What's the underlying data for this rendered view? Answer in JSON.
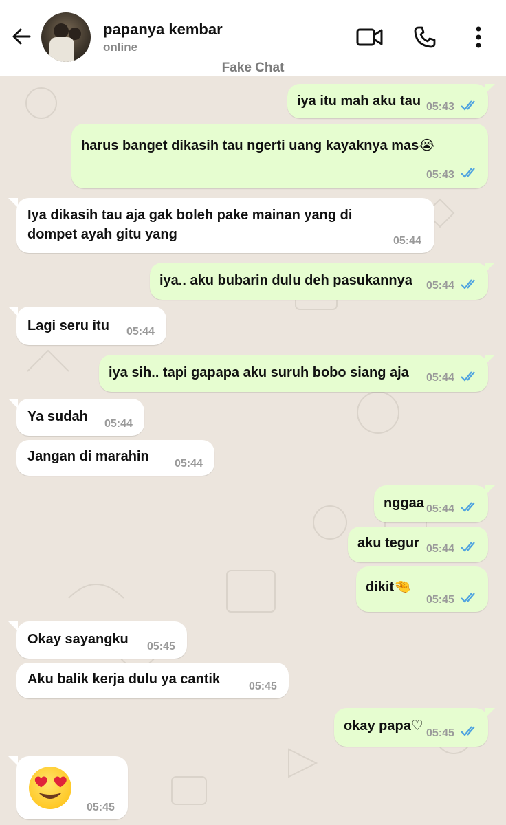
{
  "header": {
    "contact_name": "papanya kembar",
    "status": "online",
    "watermark": "Fake Chat"
  },
  "icons": {
    "back": "arrow-left-icon",
    "video": "video-camera-icon",
    "call": "phone-icon",
    "menu": "more-vertical-icon"
  },
  "colors": {
    "outgoing_bubble": "#e6fdd0",
    "incoming_bubble": "#ffffff",
    "background": "#ece5dd",
    "read_ticks": "#4fa3e0"
  },
  "messages": [
    {
      "dir": "out",
      "text": "iya itu mah aku tau",
      "time": "05:43"
    },
    {
      "dir": "out",
      "text": "harus banget dikasih tau ngerti uang kayaknya mas😭",
      "time": "05:43"
    },
    {
      "dir": "in",
      "text": "Iya dikasih tau aja gak boleh pake mainan yang di",
      "text2": "dompet ayah gitu yang",
      "time": "05:44"
    },
    {
      "dir": "out",
      "text": "iya.. aku bubarin dulu deh pasukannya",
      "time": "05:44"
    },
    {
      "dir": "in",
      "text": "Lagi seru itu",
      "time": "05:44"
    },
    {
      "dir": "out",
      "text": "iya sih.. tapi gapapa aku suruh bobo siang aja",
      "time": "05:44"
    },
    {
      "dir": "in",
      "text": "Ya sudah",
      "time": "05:44"
    },
    {
      "dir": "in",
      "text": "Jangan di marahin",
      "time": "05:44"
    },
    {
      "dir": "out",
      "text": "nggaa",
      "time": "05:44"
    },
    {
      "dir": "out",
      "text": "aku tegur",
      "time": "05:44"
    },
    {
      "dir": "out",
      "text": "dikit🤏",
      "time": "05:45"
    },
    {
      "dir": "in",
      "text": "Okay sayangku",
      "time": "05:45"
    },
    {
      "dir": "in",
      "text": "Aku balik kerja dulu ya cantik",
      "time": "05:45"
    },
    {
      "dir": "out",
      "text": "okay papa♡",
      "time": "05:45"
    },
    {
      "dir": "in",
      "text": "😍",
      "time": "05:45"
    }
  ]
}
